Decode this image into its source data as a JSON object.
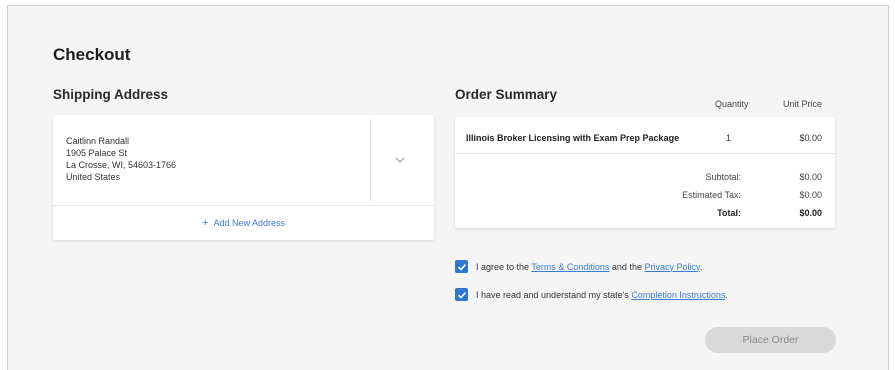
{
  "page": {
    "title": "Checkout"
  },
  "shipping": {
    "title": "Shipping Address",
    "address_lines": [
      "Caitlinn Randall",
      "1905 Palace St",
      "La Crosse, WI, 54603-1766",
      "United States"
    ],
    "add_new_label": "Add New Address",
    "icons": {
      "dropdown": "chevron-down-icon",
      "add": "plus-icon"
    }
  },
  "order": {
    "title": "Order Summary",
    "col_quantity": "Quantity",
    "col_unit_price": "Unit Price",
    "item": {
      "name": "Illinois Broker Licensing with Exam Prep Package",
      "quantity": "1",
      "price": "$0.00"
    },
    "subtotal_label": "Subtotal:",
    "subtotal_value": "$0.00",
    "tax_label": "Estimated Tax:",
    "tax_value": "$0.00",
    "total_label": "Total:",
    "total_value": "$0.00"
  },
  "agreements": {
    "terms": {
      "checked": true,
      "prefix": "I agree to the ",
      "link1": "Terms & Conditions",
      "middle": " and the ",
      "link2": "Privacy Policy",
      "suffix": "."
    },
    "instructions": {
      "checked": true,
      "prefix": "I have read and understand my state's ",
      "link": "Completion Instructions",
      "suffix": "."
    }
  },
  "actions": {
    "place_order": "Place Order"
  },
  "colors": {
    "accent": "#2f78d2",
    "link": "#3a7bd5",
    "button_disabled_bg": "#d9d9d9",
    "page_bg": "#f5f5f5"
  }
}
